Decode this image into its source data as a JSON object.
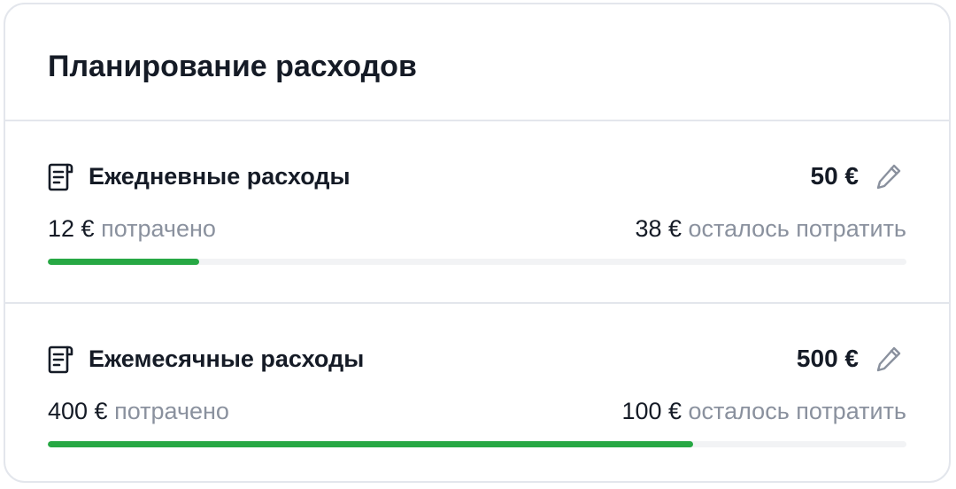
{
  "title": "Планирование расходов",
  "sections": [
    {
      "icon": "receipt-icon",
      "title": "Ежедневные расходы",
      "limit": "50 €",
      "spent_amount": "12 €",
      "spent_label": "потрачено",
      "left_amount": "38 €",
      "left_label": "осталось потратить",
      "progress_fraction": 0.176
    },
    {
      "icon": "receipt-icon",
      "title": "Ежемесячные расходы",
      "limit": "500 €",
      "spent_amount": "400 €",
      "spent_label": "потрачено",
      "left_amount": "100 €",
      "left_label": "осталось потратить",
      "progress_fraction": 0.752
    }
  ],
  "colors": {
    "progress_fill": "#27a844",
    "progress_track": "#f2f3f5",
    "text_primary": "#151b26",
    "text_muted": "#8a919e"
  }
}
